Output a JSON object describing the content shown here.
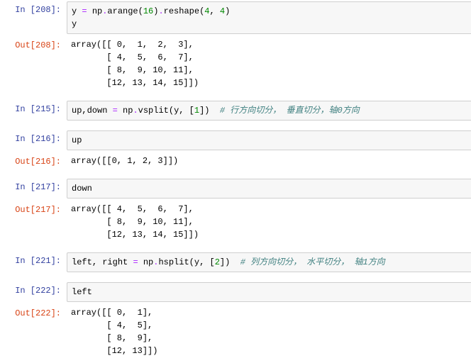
{
  "cells": [
    {
      "n": 208,
      "t": "in",
      "code": "<span class='nam'>y</span> <span class='op'>=</span> <span class='nam'>np</span><span class='op'>.</span><span class='fn'>arange</span>(<span class='num'>16</span>)<span class='op'>.</span><span class='fn'>reshape</span>(<span class='num'>4</span>, <span class='num'>4</span>)\n<span class='nam'>y</span>"
    },
    {
      "n": 208,
      "t": "out",
      "text": "array([[ 0,  1,  2,  3],\n       [ 4,  5,  6,  7],\n       [ 8,  9, 10, 11],\n       [12, 13, 14, 15]])"
    },
    {
      "gap": true
    },
    {
      "n": 215,
      "t": "in",
      "code": "<span class='nam'>up</span>,<span class='nam'>down</span> <span class='op'>=</span> <span class='nam'>np</span><span class='op'>.</span><span class='fn'>vsplit</span>(<span class='nam'>y</span>, [<span class='num'>1</span>])  <span class='cm'># 行方向切分， 垂直切分，轴0方向</span>"
    },
    {
      "gap": true
    },
    {
      "n": 216,
      "t": "in",
      "code": "<span class='nam'>up</span>"
    },
    {
      "n": 216,
      "t": "out",
      "text": "array([[0, 1, 2, 3]])"
    },
    {
      "gap": true
    },
    {
      "n": 217,
      "t": "in",
      "code": "<span class='nam'>down</span>"
    },
    {
      "n": 217,
      "t": "out",
      "text": "array([[ 4,  5,  6,  7],\n       [ 8,  9, 10, 11],\n       [12, 13, 14, 15]])"
    },
    {
      "gap": true
    },
    {
      "n": 221,
      "t": "in",
      "code": "<span class='nam'>left</span>, <span class='nam'>right</span> <span class='op'>=</span> <span class='nam'>np</span><span class='op'>.</span><span class='fn'>hsplit</span>(<span class='nam'>y</span>, [<span class='num'>2</span>])  <span class='cm'># 列方向切分， 水平切分， 轴1方向</span>"
    },
    {
      "gap": true
    },
    {
      "n": 222,
      "t": "in",
      "code": "<span class='nam'>left</span>"
    },
    {
      "n": 222,
      "t": "out",
      "text": "array([[ 0,  1],\n       [ 4,  5],\n       [ 8,  9],\n       [12, 13]])"
    }
  ],
  "labels": {
    "in": "In ",
    "out": "Out"
  }
}
